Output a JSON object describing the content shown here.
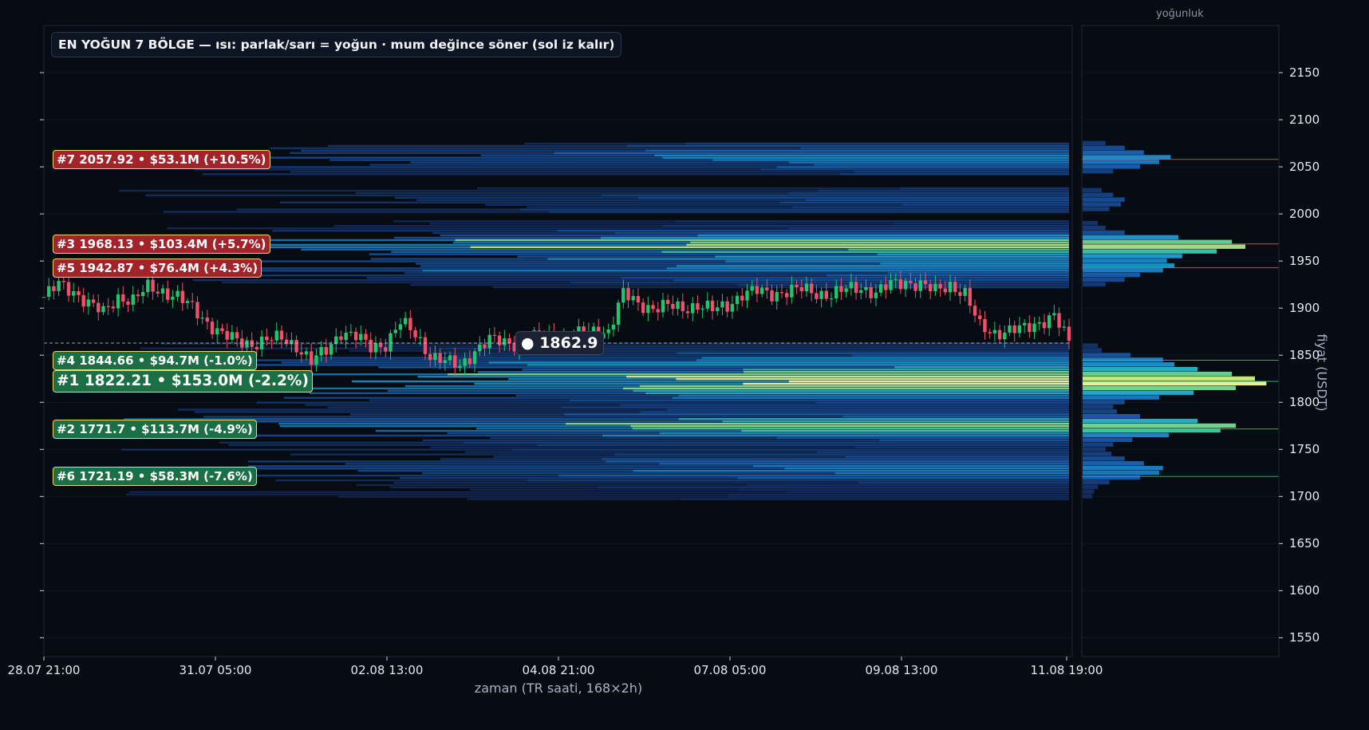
{
  "title": "EN YOĞUN 7 BÖLGE — ısı: parlak/sarı = yoğun · mum değince söner (sol iz kalır)",
  "side_panel_title": "yoğunluk",
  "current_price_label": "● 1862.9",
  "colors": {
    "background": "#070b12",
    "up_candle": "#22c46e",
    "down_candle": "#f0506a",
    "zone_up": "#a3232b",
    "zone_down": "#1a7044",
    "zone_border": "#f2d66a"
  },
  "chart_data": {
    "type": "candlestick",
    "xlabel": "zaman (TR saati, 168×2h)",
    "ylabel": "fiyat (USDT)",
    "ylim": [
      1530,
      2200
    ],
    "y_ticks": [
      1550,
      1600,
      1650,
      1700,
      1750,
      1800,
      1850,
      1900,
      1950,
      2000,
      2050,
      2100,
      2150
    ],
    "x_tick_labels": [
      "28.07 21:00",
      "31.07 05:00",
      "02.08 13:00",
      "04.08 21:00",
      "07.08 05:00",
      "09.08 13:00",
      "11.08 19:00"
    ],
    "current_price": 1862.9,
    "price_path": [
      [
        0,
        1912
      ],
      [
        3,
        1925
      ],
      [
        6,
        1918
      ],
      [
        9,
        1905
      ],
      [
        12,
        1895
      ],
      [
        15,
        1912
      ],
      [
        18,
        1908
      ],
      [
        21,
        1922
      ],
      [
        24,
        1918
      ],
      [
        27,
        1912
      ],
      [
        30,
        1900
      ],
      [
        33,
        1885
      ],
      [
        36,
        1872
      ],
      [
        39,
        1865
      ],
      [
        42,
        1862
      ],
      [
        45,
        1866
      ],
      [
        48,
        1868
      ],
      [
        51,
        1860
      ],
      [
        54,
        1843
      ],
      [
        57,
        1855
      ],
      [
        60,
        1875
      ],
      [
        63,
        1870
      ],
      [
        66,
        1858
      ],
      [
        69,
        1862
      ],
      [
        72,
        1885
      ],
      [
        75,
        1872
      ],
      [
        78,
        1850
      ],
      [
        81,
        1843
      ],
      [
        84,
        1838
      ],
      [
        87,
        1855
      ],
      [
        90,
        1866
      ],
      [
        93,
        1864
      ],
      [
        96,
        1862
      ],
      [
        99,
        1868
      ],
      [
        102,
        1870
      ],
      [
        105,
        1866
      ],
      [
        108,
        1872
      ],
      [
        111,
        1876
      ],
      [
        114,
        1875
      ],
      [
        117,
        1915
      ],
      [
        120,
        1905
      ],
      [
        123,
        1900
      ],
      [
        126,
        1902
      ],
      [
        129,
        1900
      ],
      [
        132,
        1903
      ],
      [
        135,
        1898
      ],
      [
        138,
        1903
      ],
      [
        141,
        1915
      ],
      [
        144,
        1918
      ],
      [
        147,
        1915
      ],
      [
        150,
        1918
      ],
      [
        153,
        1920
      ],
      [
        156,
        1916
      ],
      [
        159,
        1914
      ],
      [
        162,
        1920
      ],
      [
        165,
        1922
      ],
      [
        168,
        1916
      ],
      [
        171,
        1925
      ],
      [
        174,
        1928
      ],
      [
        177,
        1925
      ],
      [
        180,
        1918
      ],
      [
        183,
        1925
      ],
      [
        186,
        1915
      ],
      [
        189,
        1880
      ],
      [
        192,
        1874
      ],
      [
        195,
        1876
      ],
      [
        198,
        1878
      ],
      [
        201,
        1885
      ],
      [
        204,
        1892
      ],
      [
        207,
        1863
      ]
    ],
    "zones": [
      {
        "rank": 7,
        "price": 2057.92,
        "volume": "$53.1M",
        "change": "+10.5%",
        "text": "#7  2057.92  •  $53.1M  (+10.5%)"
      },
      {
        "rank": 3,
        "price": 1968.13,
        "volume": "$103.4M",
        "change": "+5.7%",
        "text": "#3  1968.13  •  $103.4M  (+5.7%)"
      },
      {
        "rank": 5,
        "price": 1942.87,
        "volume": "$76.4M",
        "change": "+4.3%",
        "text": "#5  1942.87  •  $76.4M  (+4.3%)"
      },
      {
        "rank": 4,
        "price": 1844.66,
        "volume": "$94.7M",
        "change": "-1.0%",
        "text": "#4  1844.66  •  $94.7M  (-1.0%)"
      },
      {
        "rank": 1,
        "price": 1822.21,
        "volume": "$153.0M",
        "change": "-2.2%",
        "text": "#1  1822.21  •  $153.0M  (-2.2%)"
      },
      {
        "rank": 2,
        "price": 1771.7,
        "volume": "$113.7M",
        "change": "-4.9%",
        "text": "#2  1771.7  •  $113.7M  (-4.9%)"
      },
      {
        "rank": 6,
        "price": 1721.19,
        "volume": "$58.3M",
        "change": "-7.6%",
        "text": "#6  1721.19  •  $58.3M  (-7.6%)"
      }
    ],
    "density_profile": [
      [
        1700,
        0.05
      ],
      [
        1705,
        0.06
      ],
      [
        1710,
        0.08
      ],
      [
        1715,
        0.14
      ],
      [
        1720,
        0.3
      ],
      [
        1725,
        0.4
      ],
      [
        1730,
        0.42
      ],
      [
        1735,
        0.32
      ],
      [
        1740,
        0.22
      ],
      [
        1745,
        0.15
      ],
      [
        1750,
        0.12
      ],
      [
        1755,
        0.16
      ],
      [
        1760,
        0.26
      ],
      [
        1765,
        0.45
      ],
      [
        1770,
        0.72
      ],
      [
        1775,
        0.8
      ],
      [
        1780,
        0.6
      ],
      [
        1785,
        0.3
      ],
      [
        1790,
        0.18
      ],
      [
        1795,
        0.16
      ],
      [
        1800,
        0.22
      ],
      [
        1805,
        0.4
      ],
      [
        1810,
        0.58
      ],
      [
        1815,
        0.8
      ],
      [
        1820,
        0.96
      ],
      [
        1825,
        0.9
      ],
      [
        1830,
        0.78
      ],
      [
        1835,
        0.6
      ],
      [
        1840,
        0.48
      ],
      [
        1845,
        0.42
      ],
      [
        1850,
        0.25
      ],
      [
        1855,
        0.1
      ],
      [
        1860,
        0.08
      ],
      [
        1925,
        0.12
      ],
      [
        1930,
        0.22
      ],
      [
        1935,
        0.3
      ],
      [
        1940,
        0.42
      ],
      [
        1945,
        0.48
      ],
      [
        1950,
        0.44
      ],
      [
        1955,
        0.52
      ],
      [
        1960,
        0.7
      ],
      [
        1965,
        0.85
      ],
      [
        1970,
        0.78
      ],
      [
        1975,
        0.5
      ],
      [
        1980,
        0.22
      ],
      [
        1985,
        0.12
      ],
      [
        1990,
        0.08
      ],
      [
        2005,
        0.14
      ],
      [
        2010,
        0.2
      ],
      [
        2015,
        0.22
      ],
      [
        2020,
        0.16
      ],
      [
        2025,
        0.1
      ],
      [
        2045,
        0.16
      ],
      [
        2050,
        0.3
      ],
      [
        2055,
        0.4
      ],
      [
        2060,
        0.46
      ],
      [
        2065,
        0.32
      ],
      [
        2070,
        0.22
      ],
      [
        2075,
        0.12
      ]
    ]
  }
}
